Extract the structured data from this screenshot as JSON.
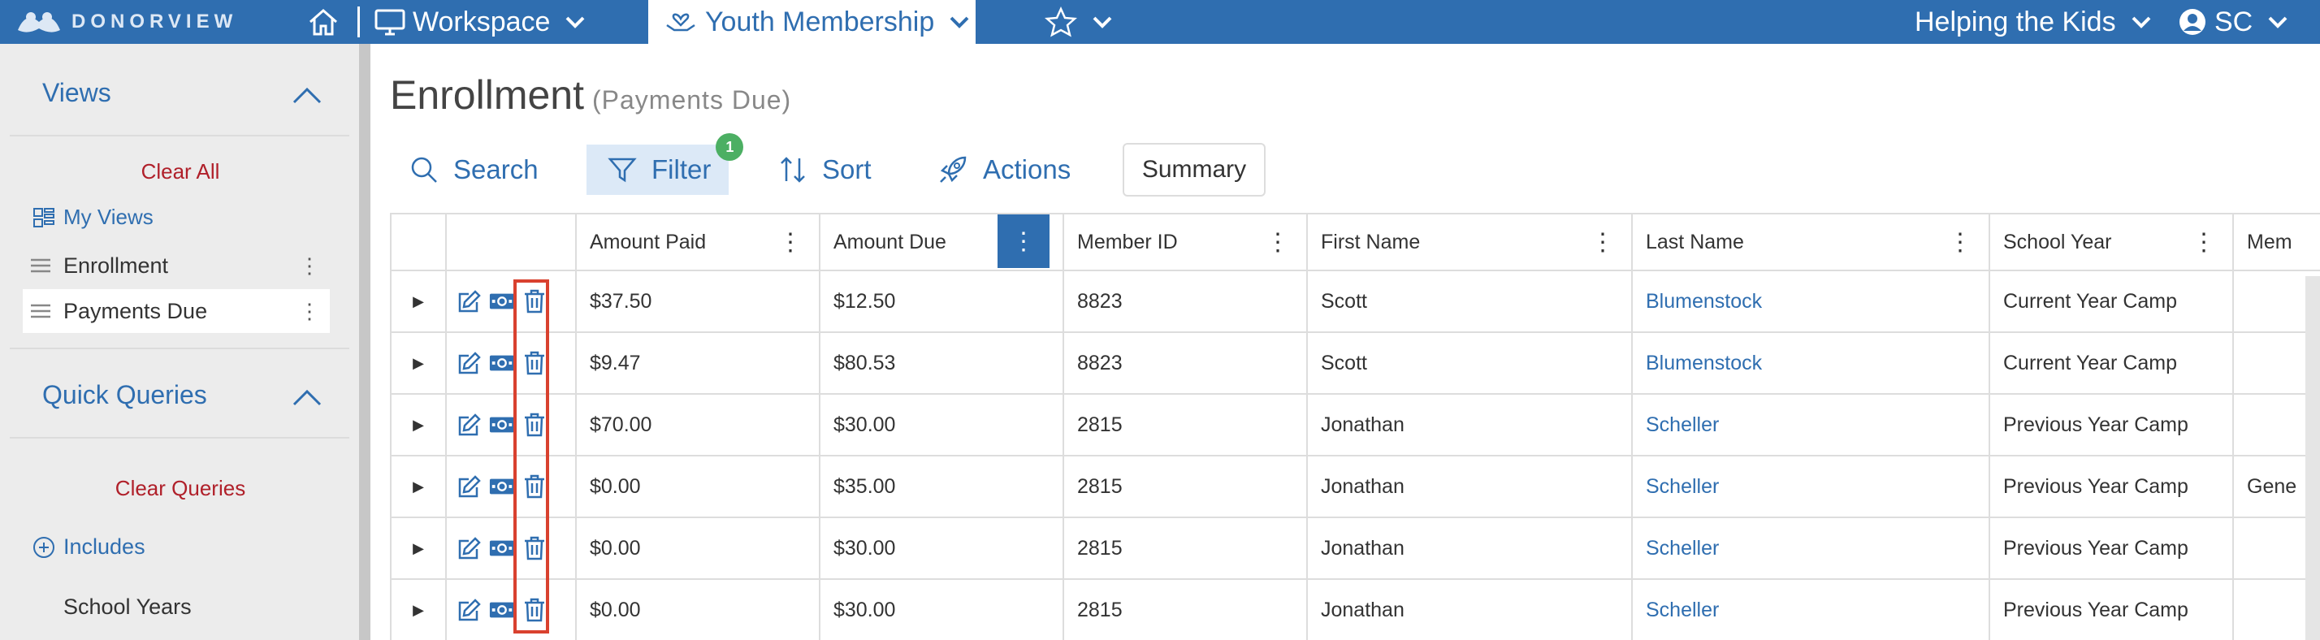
{
  "nav": {
    "logo_text": "DONORVIEW",
    "workspace_label": "Workspace",
    "module_label": "Youth Membership",
    "org_label": "Helping the Kids",
    "user_initials": "SC"
  },
  "sidebar": {
    "views_heading": "Views",
    "clear_all": "Clear All",
    "my_views": "My Views",
    "views": [
      {
        "label": "Enrollment"
      },
      {
        "label": "Payments Due"
      }
    ],
    "quick_queries_heading": "Quick Queries",
    "clear_queries": "Clear Queries",
    "includes": "Includes",
    "school_years": "School Years"
  },
  "page": {
    "title": "Enrollment",
    "subtitle": "(Payments Due)"
  },
  "toolbar": {
    "search": "Search",
    "filter": "Filter",
    "filter_badge": "1",
    "sort": "Sort",
    "actions": "Actions",
    "summary": "Summary"
  },
  "table": {
    "columns": [
      "Amount Paid",
      "Amount Due",
      "Member ID",
      "First Name",
      "Last Name",
      "School Year",
      "Mem"
    ],
    "rows": [
      {
        "amount_paid": "$37.50",
        "amount_due": "$12.50",
        "member_id": "8823",
        "first_name": "Scott",
        "last_name": "Blumenstock",
        "school_year": "Current Year Camp",
        "mem": ""
      },
      {
        "amount_paid": "$9.47",
        "amount_due": "$80.53",
        "member_id": "8823",
        "first_name": "Scott",
        "last_name": "Blumenstock",
        "school_year": "Current Year Camp",
        "mem": ""
      },
      {
        "amount_paid": "$70.00",
        "amount_due": "$30.00",
        "member_id": "2815",
        "first_name": "Jonathan",
        "last_name": "Scheller",
        "school_year": "Previous Year Camp",
        "mem": ""
      },
      {
        "amount_paid": "$0.00",
        "amount_due": "$35.00",
        "member_id": "2815",
        "first_name": "Jonathan",
        "last_name": "Scheller",
        "school_year": "Previous Year Camp",
        "mem": "Gene"
      },
      {
        "amount_paid": "$0.00",
        "amount_due": "$30.00",
        "member_id": "2815",
        "first_name": "Jonathan",
        "last_name": "Scheller",
        "school_year": "Previous Year Camp",
        "mem": ""
      },
      {
        "amount_paid": "$0.00",
        "amount_due": "$30.00",
        "member_id": "2815",
        "first_name": "Jonathan",
        "last_name": "Scheller",
        "school_year": "Previous Year Camp",
        "mem": ""
      }
    ]
  },
  "colors": {
    "brand": "#2f6eb0",
    "danger": "#b0202a",
    "highlight": "#d9412f",
    "badge": "#4caf63"
  }
}
